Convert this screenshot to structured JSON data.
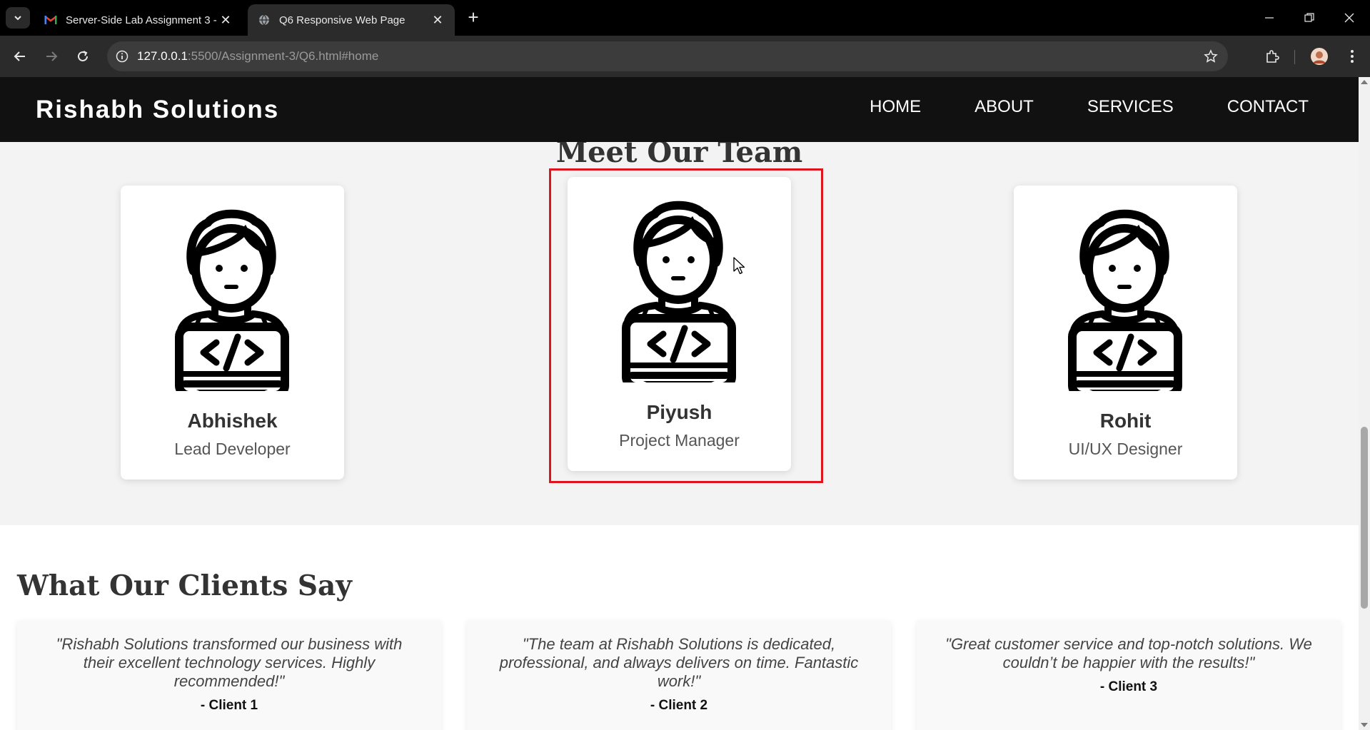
{
  "browser": {
    "tabs": [
      {
        "title": "Server-Side Lab Assignment 3 -",
        "favicon": "gmail-icon",
        "active": false
      },
      {
        "title": "Q6 Responsive Web Page",
        "favicon": "globe-icon",
        "active": true
      }
    ],
    "url_host": "127.0.0.1",
    "url_rest": ":5500/Assignment-3/Q6.html#home"
  },
  "site": {
    "brand": "Rishabh Solutions",
    "nav": [
      "HOME",
      "ABOUT",
      "SERVICES",
      "CONTACT"
    ]
  },
  "team": {
    "title": "Meet Our Team",
    "members": [
      {
        "name": "Abhishek",
        "role": "Lead Developer"
      },
      {
        "name": "Piyush",
        "role": "Project Manager"
      },
      {
        "name": "Rohit",
        "role": "UI/UX Designer"
      }
    ]
  },
  "clients": {
    "title": "What Our Clients Say",
    "testimonials": [
      {
        "quote": "\"Rishabh Solutions transformed our business with their excellent technology services. Highly recommended!\"",
        "author": "- Client 1"
      },
      {
        "quote": "\"The team at Rishabh Solutions is dedicated, professional, and always delivers on time. Fantastic work!\"",
        "author": "- Client 2"
      },
      {
        "quote": "\"Great customer service and top-notch solutions. We couldn’t be happier with the results!\"",
        "author": "- Client 3"
      }
    ]
  },
  "colors": {
    "header_bg": "#111111",
    "section_bg": "#f3f3f3",
    "highlight_border": "#e0141e"
  }
}
